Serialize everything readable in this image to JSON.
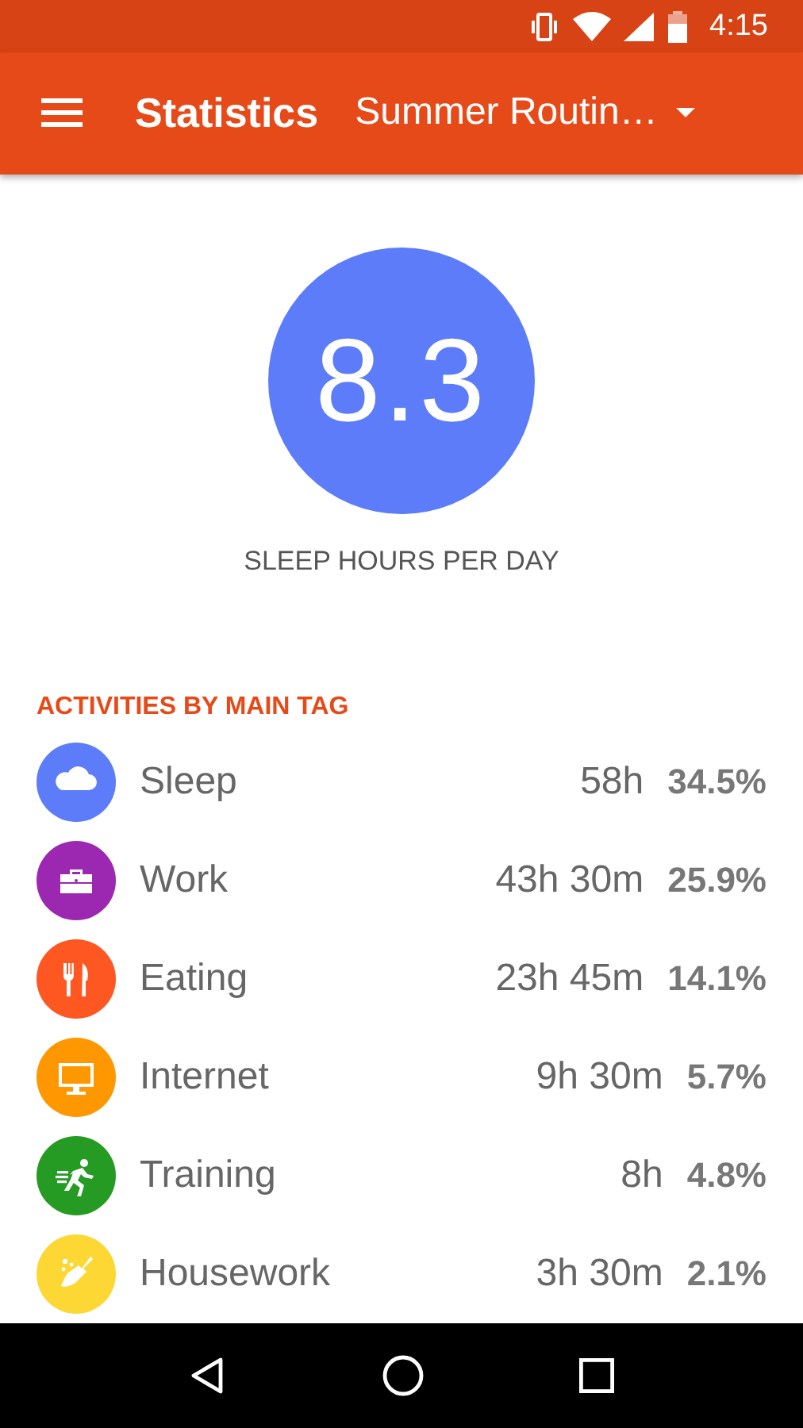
{
  "status_bar": {
    "time": "4:15"
  },
  "toolbar": {
    "title": "Statistics",
    "routine": "Summer Routin…"
  },
  "summary": {
    "value": "8.3",
    "label": "SLEEP HOURS PER DAY"
  },
  "section_title": "ACTIVITIES BY MAIN TAG",
  "activities": [
    {
      "kind": "cloud",
      "name": "Sleep",
      "duration": "58h",
      "percent": "34.5%",
      "color": "#5c7cfa"
    },
    {
      "kind": "briefcase",
      "name": "Work",
      "duration": "43h 30m",
      "percent": "25.9%",
      "color": "#9c27b0"
    },
    {
      "kind": "cutlery",
      "name": "Eating",
      "duration": "23h 45m",
      "percent": "14.1%",
      "color": "#ff5722"
    },
    {
      "kind": "monitor",
      "name": "Internet",
      "duration": "9h 30m",
      "percent": "5.7%",
      "color": "#ff9800"
    },
    {
      "kind": "runner",
      "name": "Training",
      "duration": "8h",
      "percent": "4.8%",
      "color": "#259b24"
    },
    {
      "kind": "broom",
      "name": "Housework",
      "duration": "3h 30m",
      "percent": "2.1%",
      "color": "#fdd835"
    }
  ]
}
